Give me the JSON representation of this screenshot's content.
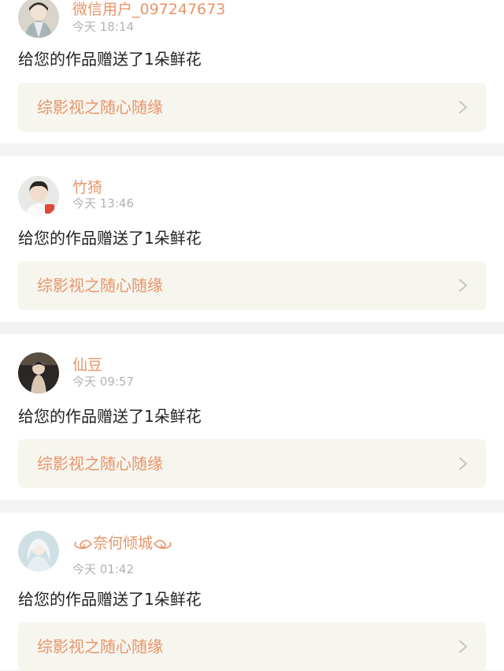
{
  "notifications": [
    {
      "username": "微信用户_097247673",
      "time": "今天 18:14",
      "message": "给您的作品赠送了1朵鲜花",
      "work_title": "综影视之随心随缘",
      "avatar": "avatar-ancient-costume-figure"
    },
    {
      "username": "竹猗",
      "time": "今天 13:46",
      "message": "给您的作品赠送了1朵鲜花",
      "work_title": "综影视之随心随缘",
      "avatar": "avatar-young-man-portrait"
    },
    {
      "username": "仙豆",
      "time": "今天 09:57",
      "message": "给您的作品赠送了1朵鲜花",
      "work_title": "综影视之随心随缘",
      "avatar": "avatar-dark-figure-portrait"
    },
    {
      "username": "奈何倾城",
      "time": "今天 01:42",
      "message": "给您的作品赠送了1朵鲜花",
      "work_title": "综影视之随心随缘",
      "avatar": "avatar-white-haired-figure"
    }
  ],
  "colors": {
    "accent": "#e8956a",
    "page_background": "#f3f3f3",
    "card_background": "#ffffff",
    "link_background": "#f6f5ee",
    "time_text": "#b3b3b3",
    "message_text": "#222222"
  }
}
